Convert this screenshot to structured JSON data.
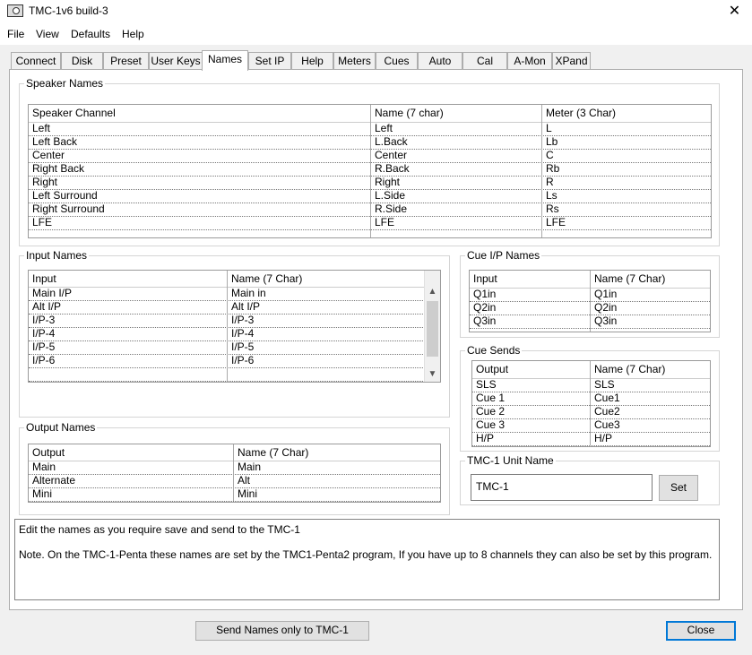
{
  "window": {
    "title": "TMC-1v6 build-3",
    "close_glyph": "✕"
  },
  "menu": [
    "File",
    "View",
    "Defaults",
    "Help"
  ],
  "tabs": [
    "Connect",
    "Disk",
    "Preset",
    "User Keys",
    "Names",
    "Set IP",
    "Help",
    "Meters",
    "Cues",
    "Auto",
    "Cal",
    "A-Mon",
    "XPand"
  ],
  "active_tab": "Names",
  "speaker_names": {
    "title": "Speaker Names",
    "headers": [
      "Speaker Channel",
      "Name (7 char)",
      "Meter (3 Char)"
    ],
    "rows": [
      [
        "Left",
        "Left",
        "L"
      ],
      [
        "Left Back",
        "L.Back",
        "Lb"
      ],
      [
        "Center",
        "Center",
        "C"
      ],
      [
        "Right Back",
        "R.Back",
        "Rb"
      ],
      [
        "Right",
        "Right",
        "R"
      ],
      [
        "Left Surround",
        "L.Side",
        "Ls"
      ],
      [
        "Right Surround",
        "R.Side",
        "Rs"
      ],
      [
        "LFE",
        "LFE",
        "LFE"
      ],
      [
        "",
        "",
        ""
      ]
    ]
  },
  "input_names": {
    "title": "Input Names",
    "headers": [
      "Input",
      "Name (7 Char)"
    ],
    "rows": [
      [
        "Main I/P",
        "Main in"
      ],
      [
        "Alt I/P",
        "Alt I/P"
      ],
      [
        "I/P-3",
        "I/P-3"
      ],
      [
        "I/P-4",
        "I/P-4"
      ],
      [
        "I/P-5",
        "I/P-5"
      ],
      [
        "I/P-6",
        "I/P-6"
      ],
      [
        "",
        ""
      ]
    ],
    "scroll_up": "▲",
    "scroll_down": "▼"
  },
  "output_names": {
    "title": "Output Names",
    "headers": [
      "Output",
      "Name (7 Char)"
    ],
    "rows": [
      [
        "Main",
        "Main"
      ],
      [
        "Alternate",
        "Alt"
      ],
      [
        "Mini",
        "Mini"
      ]
    ]
  },
  "cue_ip_names": {
    "title": "Cue I/P Names",
    "headers": [
      "Input",
      "Name (7 Char)"
    ],
    "rows": [
      [
        "Q1in",
        "Q1in"
      ],
      [
        "Q2in",
        "Q2in"
      ],
      [
        "Q3in",
        "Q3in"
      ],
      [
        "",
        ""
      ]
    ]
  },
  "cue_sends": {
    "title": "Cue Sends",
    "headers": [
      "Output",
      "Name (7 Char)"
    ],
    "rows": [
      [
        "SLS",
        "SLS"
      ],
      [
        "Cue 1",
        "Cue1"
      ],
      [
        "Cue 2",
        "Cue2"
      ],
      [
        "Cue 3",
        "Cue3"
      ],
      [
        "H/P",
        "H/P"
      ]
    ]
  },
  "unit_name": {
    "title": "TMC-1 Unit  Name",
    "value": "TMC-1",
    "set_label": "Set"
  },
  "notes": {
    "line1": "Edit the names as you require save and send to the TMC-1",
    "line2": "Note. On the TMC-1-Penta these names are set by the TMC1-Penta2 program, If you have up to 8 channels they can also be set by this program."
  },
  "buttons": {
    "send": "Send Names only to TMC-1",
    "close": "Close"
  }
}
